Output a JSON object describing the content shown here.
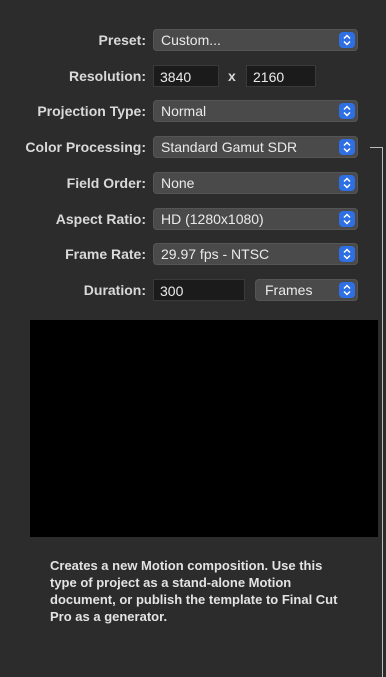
{
  "form": {
    "preset": {
      "label": "Preset:",
      "value": "Custom..."
    },
    "resolution": {
      "label": "Resolution:",
      "width": "3840",
      "separator": "x",
      "height": "2160"
    },
    "projection_type": {
      "label": "Projection Type:",
      "value": "Normal"
    },
    "color_processing": {
      "label": "Color Processing:",
      "value": "Standard Gamut SDR"
    },
    "field_order": {
      "label": "Field Order:",
      "value": "None"
    },
    "aspect_ratio": {
      "label": "Aspect Ratio:",
      "value": "HD (1280x1080)"
    },
    "frame_rate": {
      "label": "Frame Rate:",
      "value": "29.97 fps - NTSC"
    },
    "duration": {
      "label": "Duration:",
      "value": "300",
      "unit": "Frames"
    }
  },
  "description": "Creates a new Motion composition. Use this type of project as a stand-alone Motion document, or publish the template to Final Cut Pro as a generator.",
  "icons": {
    "popup": "chevron-updown-icon"
  },
  "colors": {
    "accent": "#2f6fe4",
    "panel": "#2c2c2c",
    "preview": "#000000"
  }
}
